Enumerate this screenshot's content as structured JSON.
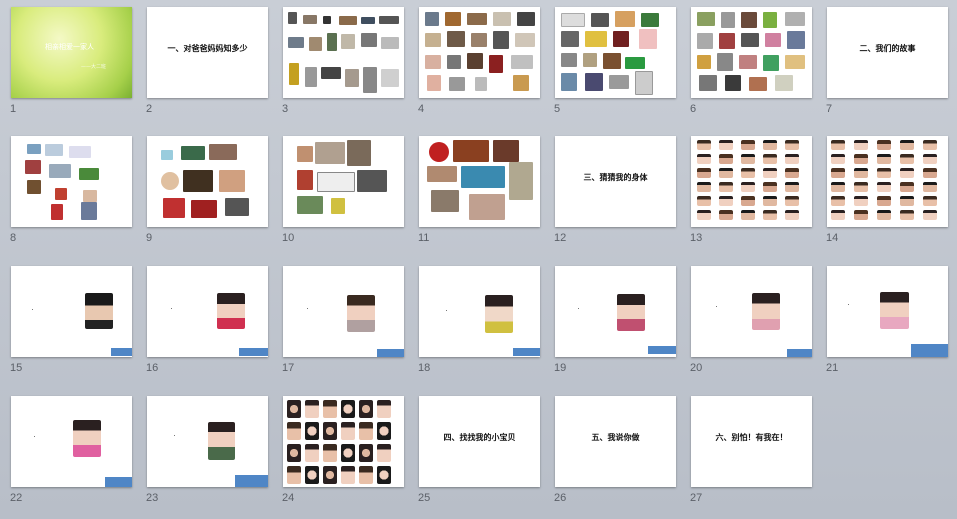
{
  "slides": [
    {
      "n": "1",
      "title": "相亲相爱一家人",
      "subtitle": "——大二班"
    },
    {
      "n": "2",
      "title": "一、对爸爸妈妈知多少"
    },
    {
      "n": "3"
    },
    {
      "n": "4"
    },
    {
      "n": "5"
    },
    {
      "n": "6"
    },
    {
      "n": "7",
      "title": "二、我们的故事"
    },
    {
      "n": "8"
    },
    {
      "n": "9"
    },
    {
      "n": "10"
    },
    {
      "n": "11"
    },
    {
      "n": "12",
      "title": "三、猜猜我的身体"
    },
    {
      "n": "13"
    },
    {
      "n": "14"
    },
    {
      "n": "15"
    },
    {
      "n": "16"
    },
    {
      "n": "17"
    },
    {
      "n": "18"
    },
    {
      "n": "19"
    },
    {
      "n": "20"
    },
    {
      "n": "21"
    },
    {
      "n": "22"
    },
    {
      "n": "23"
    },
    {
      "n": "24"
    },
    {
      "n": "25",
      "title": "四、找找我的小宝贝"
    },
    {
      "n": "26",
      "title": "五、我说你做"
    },
    {
      "n": "27",
      "title": "六、别怕！有我在！"
    }
  ]
}
